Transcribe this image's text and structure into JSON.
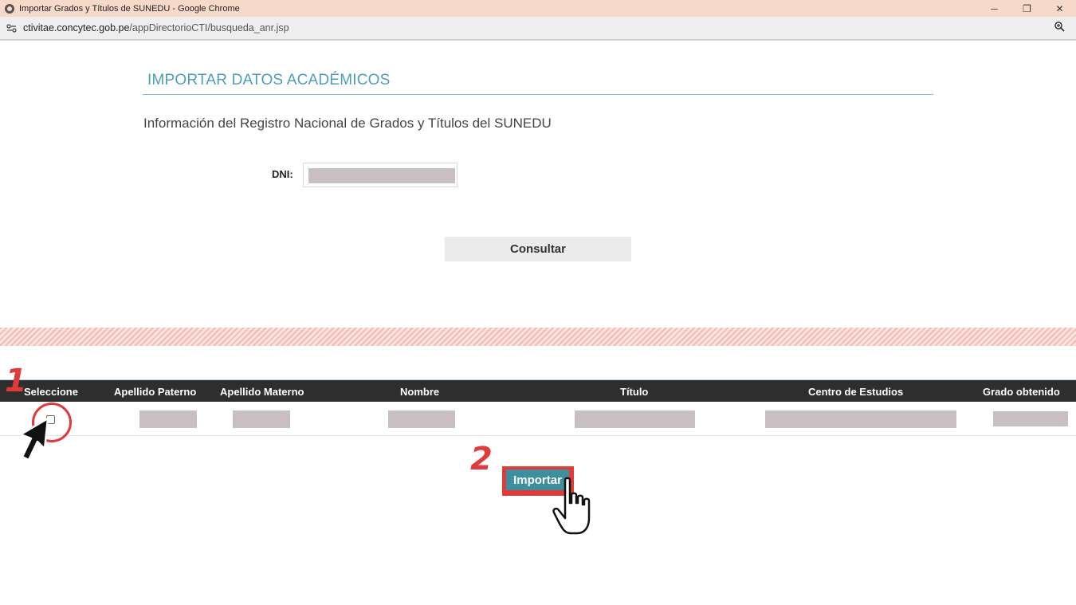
{
  "window": {
    "title": "Importar Grados y Títulos de SUNEDU - Google Chrome",
    "controls": {
      "minimize": "─",
      "restore": "❐",
      "close": "✕"
    }
  },
  "address_bar": {
    "url_host": "ctivitae.concytec.gob.pe",
    "url_path": "/appDirectorioCTI/busqueda_anr.jsp"
  },
  "form": {
    "section_title": "IMPORTAR DATOS ACADÉMICOS",
    "subtitle": "Información del Registro Nacional de Grados y Títulos del SUNEDU",
    "dni_label": "DNI:",
    "consultar_label": "Consultar"
  },
  "table": {
    "headers": [
      "Seleccione",
      "Apellido Paterno",
      "Apellido Materno",
      "Nombre",
      "Título",
      "Centro de Estudios",
      "Grado obtenido"
    ]
  },
  "actions": {
    "importar_label": "Importar"
  },
  "annotations": {
    "step_1": "1",
    "step_2": "2",
    "highlight_color": "#e03a3a"
  },
  "colors": {
    "accent": "#4c9fb3",
    "header_bg": "#2e2e2e",
    "import_button": "#3d8fa0"
  }
}
